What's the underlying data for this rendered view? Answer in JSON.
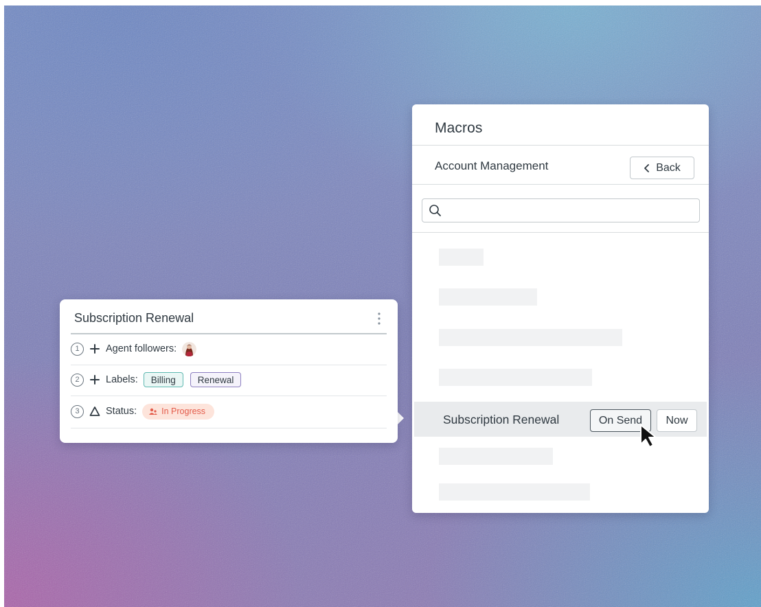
{
  "macros_panel": {
    "title": "Macros",
    "category": "Account Management",
    "back_label": "Back",
    "search": {
      "value": "",
      "placeholder": ""
    },
    "selected_macro": {
      "label": "Subscription Renewal",
      "on_send_label": "On Send",
      "now_label": "Now"
    }
  },
  "preview": {
    "title": "Subscription Renewal",
    "actions": [
      {
        "step": "1",
        "icon": "plus-icon",
        "label": "Agent followers:"
      },
      {
        "step": "2",
        "icon": "plus-icon",
        "label": "Labels:",
        "tags": [
          "Billing",
          "Renewal"
        ]
      },
      {
        "step": "3",
        "icon": "triangle-icon",
        "label": "Status:",
        "status": "In Progress"
      }
    ]
  },
  "colors": {
    "text": "#2f3941",
    "border": "#c2c8cc",
    "status_text": "#e35b4a",
    "status_bg": "#fde4db",
    "billing_tag": "#5eb8b0",
    "renewal_tag": "#8d7fc0"
  }
}
